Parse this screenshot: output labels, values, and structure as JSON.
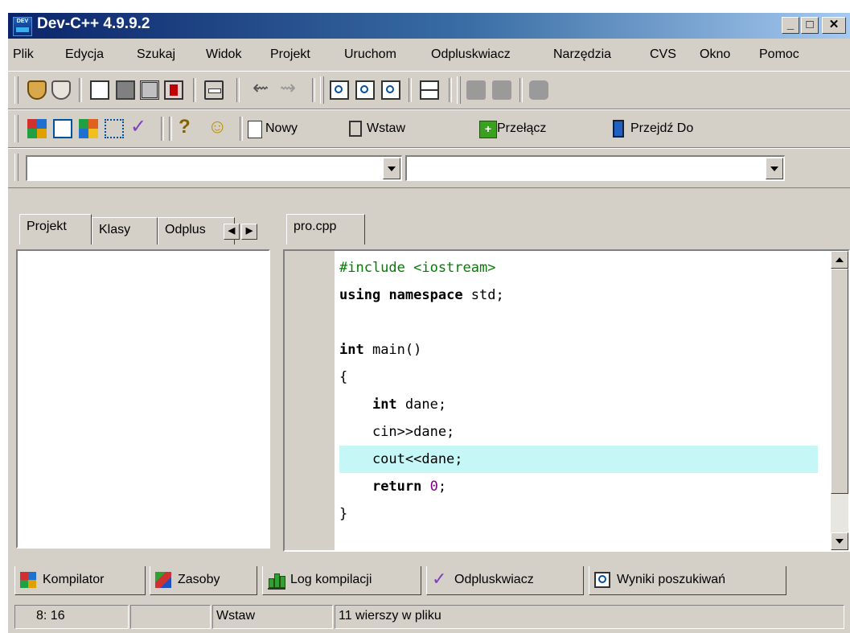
{
  "window": {
    "title": "Dev-C++ 4.9.9.2",
    "icon_label": "DEV",
    "minimize_glyph": "_",
    "maximize_glyph": "□",
    "close_glyph": "✕"
  },
  "menu": [
    "Plik",
    "Edycja",
    "Szukaj",
    "Widok",
    "Projekt",
    "Uruchom",
    "Odpluskwiacz",
    "Narzędzia",
    "CVS",
    "Okno",
    "Pomoc"
  ],
  "toolbar2": {
    "help_glyph": "?",
    "about_glyph": "☺",
    "new_label": "Nowy",
    "insert_label": "Wstaw",
    "toggle_label": "Przełącz",
    "goto_label": "Przejdź Do"
  },
  "combos": {
    "class_value": "",
    "member_value": ""
  },
  "left_panel": {
    "tabs": [
      "Projekt",
      "Klasy",
      "Odplus"
    ]
  },
  "editor": {
    "tab_label": "pro.cpp",
    "highlight_line_index": 7,
    "lines": [
      [
        {
          "t": "#include <iostream>",
          "c": "pp"
        }
      ],
      [
        {
          "t": "using",
          "c": "kw"
        },
        {
          "t": " ",
          "c": ""
        },
        {
          "t": "namespace",
          "c": "kw"
        },
        {
          "t": " std;",
          "c": ""
        }
      ],
      [],
      [
        {
          "t": "int",
          "c": "kw"
        },
        {
          "t": " main()",
          "c": ""
        }
      ],
      [
        {
          "t": "{",
          "c": ""
        }
      ],
      [
        {
          "t": "    ",
          "c": ""
        },
        {
          "t": "int",
          "c": "kw"
        },
        {
          "t": " dane;",
          "c": ""
        }
      ],
      [
        {
          "t": "    cin>>dane;",
          "c": ""
        }
      ],
      [
        {
          "t": "    cout<<dane;",
          "c": ""
        }
      ],
      [
        {
          "t": "    ",
          "c": ""
        },
        {
          "t": "return",
          "c": "kw"
        },
        {
          "t": " ",
          "c": ""
        },
        {
          "t": "0",
          "c": "num"
        },
        {
          "t": ";",
          "c": ""
        }
      ],
      [
        {
          "t": "}",
          "c": ""
        }
      ]
    ]
  },
  "bottom_tabs": [
    "Kompilator",
    "Zasoby",
    "Log kompilacji",
    "Odpluskwiacz",
    "Wyniki poszukiwań"
  ],
  "status": {
    "position": "8: 16",
    "modified": "",
    "mode": "Wstaw",
    "lines_info": "11 wierszy w pliku"
  },
  "colors": {
    "title_gradient_start": "#0a246a",
    "current_line": "#c6f7f7",
    "preprocessor": "#008000",
    "number": "#800080"
  }
}
